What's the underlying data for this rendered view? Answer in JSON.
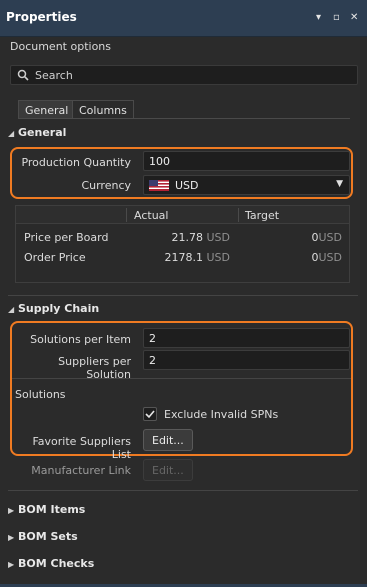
{
  "panel": {
    "title": "Properties",
    "window_buttons": {
      "pin": "▾",
      "maximize": "▫",
      "close": "✕"
    }
  },
  "document_options_label": "Document options",
  "search": {
    "placeholder": "Search",
    "icon": "search-icon"
  },
  "tabs": [
    {
      "label": "General",
      "active": true
    },
    {
      "label": "Columns",
      "active": false
    }
  ],
  "general": {
    "header": "General",
    "production_quantity_label": "Production Quantity",
    "production_quantity_value": "100",
    "currency_label": "Currency",
    "currency_value": "USD",
    "currency_flag_icon": "us-flag-icon"
  },
  "price_table": {
    "columns": [
      "Actual",
      "Target"
    ],
    "rows": [
      {
        "label": "Price per Board",
        "actual": "21.78",
        "actual_unit": "USD",
        "target": "0",
        "target_unit": "USD"
      },
      {
        "label": "Order Price",
        "actual": "2178.1",
        "actual_unit": "USD",
        "target": "0",
        "target_unit": "USD"
      }
    ]
  },
  "supply_chain": {
    "header": "Supply Chain",
    "solutions_per_item_label": "Solutions per Item",
    "solutions_per_item_value": "2",
    "suppliers_per_solution_label": "Suppliers per Solution",
    "suppliers_per_solution_value": "2",
    "solutions_label": "Solutions",
    "exclude_invalid_spns_label": "Exclude Invalid SPNs",
    "exclude_invalid_spns_checked": true,
    "favorite_suppliers_label": "Favorite Suppliers List",
    "favorite_suppliers_button": "Edit...",
    "manufacturer_link_label": "Manufacturer Link",
    "manufacturer_link_button": "Edit..."
  },
  "collapsed_sections": [
    "BOM Items",
    "BOM Sets",
    "BOM Checks"
  ],
  "colors": {
    "accent_outline": "#f07b22",
    "titlebar": "#2d3e52",
    "background": "#2b2b2b"
  }
}
